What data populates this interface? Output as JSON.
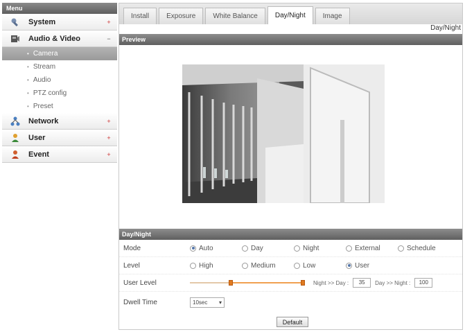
{
  "sidebar": {
    "header": "Menu",
    "categories": [
      {
        "label": "System",
        "toggle": "+"
      },
      {
        "label": "Audio & Video",
        "toggle": "−"
      },
      {
        "label": "Network",
        "toggle": "+"
      },
      {
        "label": "User",
        "toggle": "+"
      },
      {
        "label": "Event",
        "toggle": "+"
      }
    ],
    "subitems": [
      {
        "label": "Camera",
        "active": true
      },
      {
        "label": "Stream",
        "active": false
      },
      {
        "label": "Audio",
        "active": false
      },
      {
        "label": "PTZ config",
        "active": false
      },
      {
        "label": "Preset",
        "active": false
      }
    ]
  },
  "tabs": [
    {
      "label": "Install"
    },
    {
      "label": "Exposure"
    },
    {
      "label": "White Balance"
    },
    {
      "label": "Day/Night",
      "active": true
    },
    {
      "label": "Image"
    }
  ],
  "breadcrumb": "Day/Night",
  "preview": {
    "header": "Preview"
  },
  "daynight": {
    "header": "Day/Night",
    "mode": {
      "label": "Mode",
      "options": [
        "Auto",
        "Day",
        "Night",
        "External",
        "Schedule"
      ],
      "selected": "Auto"
    },
    "level": {
      "label": "Level",
      "options": [
        "High",
        "Medium",
        "Low",
        "User"
      ],
      "selected": "User"
    },
    "user_level": {
      "label": "User Level",
      "night_to_day_label": "Night >> Day :",
      "night_to_day_value": "35",
      "day_to_night_label": "Day >> Night :",
      "day_to_night_value": "100",
      "range_low_fraction": 0.35,
      "range_high_fraction": 1.0
    },
    "dwell": {
      "label": "Dwell Time",
      "value": "10sec"
    },
    "default_button": "Default"
  },
  "colors": {
    "accent": "#e07a20",
    "header": "#6e6e6e"
  }
}
